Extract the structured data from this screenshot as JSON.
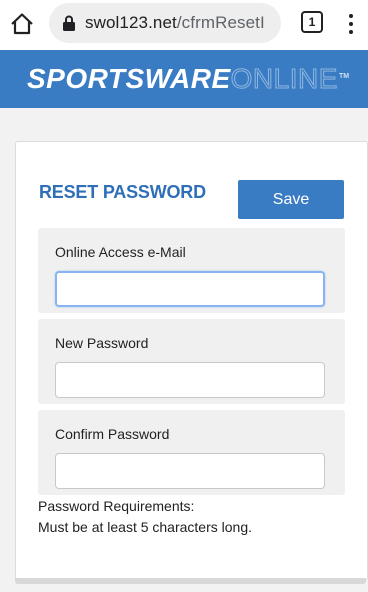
{
  "browser": {
    "url_domain": "swol123.net",
    "url_path": "/cfrmResetI",
    "tab_count": "1",
    "icons": [
      "home-icon",
      "lock-icon",
      "tabs-icon",
      "more-vert-icon"
    ]
  },
  "header": {
    "logo_part1": "SPORTSWARE",
    "logo_part2": "ONLINE",
    "logo_tm": "TM",
    "background": "#3a7cc3"
  },
  "form": {
    "title": "RESET PASSWORD",
    "save_label": "Save",
    "fields": [
      {
        "label": "Online Access e-Mail",
        "value": ""
      },
      {
        "label": "New Password",
        "value": ""
      },
      {
        "label": "Confirm Password",
        "value": ""
      }
    ],
    "requirements_heading": "Password Requirements:",
    "requirements_text": "Must be at least 5 characters long."
  },
  "colors": {
    "accent": "#3a7cc3",
    "title": "#2e6fb8",
    "field_background": "#f0f0f0"
  }
}
